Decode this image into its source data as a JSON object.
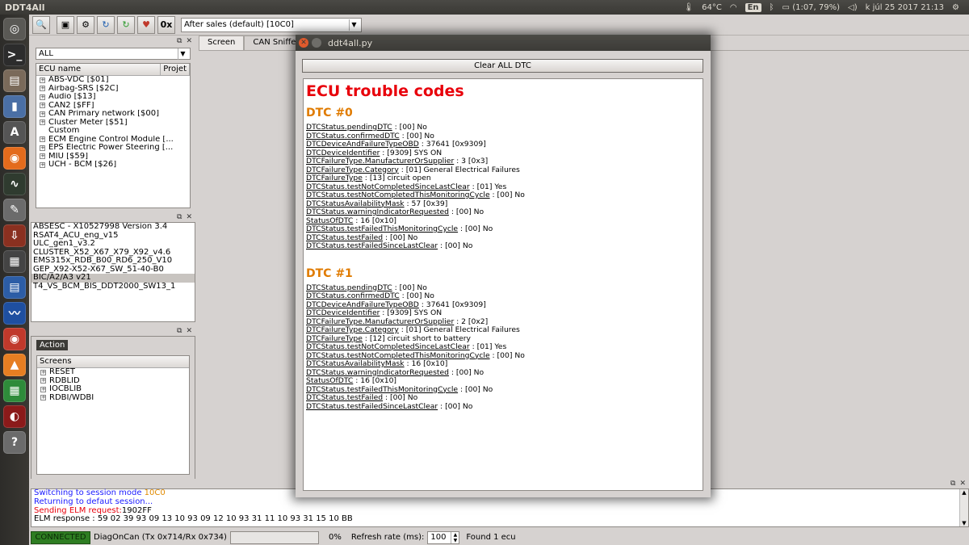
{
  "top_panel": {
    "app_title": "DDT4All",
    "temperature": "64°C",
    "keyboard_layout": "En",
    "battery": "(1:07, 79%)",
    "datetime": "k júl 25 2017 21:13"
  },
  "toolbar": {
    "ecu_select_value": "After sales (default) [10C0]",
    "hex_button": "0x"
  },
  "ecu_panel": {
    "filter_value": "ALL",
    "columns": [
      "ECU name",
      "Projet"
    ],
    "items": [
      {
        "label": "ABS-VDC [$01]",
        "expandable": true
      },
      {
        "label": "Airbag-SRS [$2C]",
        "expandable": true
      },
      {
        "label": "Audio [$13]",
        "expandable": true
      },
      {
        "label": "CAN2 [$FF]",
        "expandable": true
      },
      {
        "label": "CAN Primary network [$00]",
        "expandable": true
      },
      {
        "label": "Cluster Meter [$51]",
        "expandable": true
      },
      {
        "label": "Custom",
        "expandable": false
      },
      {
        "label": "ECM Engine Control Module [...",
        "expandable": true
      },
      {
        "label": "EPS Electric Power Steering [...",
        "expandable": true
      },
      {
        "label": "MIU [$59]",
        "expandable": true
      },
      {
        "label": "UCH - BCM [$26]",
        "expandable": true
      }
    ]
  },
  "files_panel": {
    "items": [
      "ABSESC - X10527998 Version 3.4",
      "RSAT4_ACU_eng_v15",
      "ULC_gen1_v3.2",
      "CLUSTER_X52_X67_X79_X92_v4.6",
      "EMS315x_RDB_B00_RD6_250_V10",
      "GEP_X92-X52-X67_SW_51-40-B0",
      "BIC/A2/A3 v21",
      "T4_VS_BCM_BIS_DDT2000_SW13_1"
    ],
    "selected_index": 6
  },
  "screens_panel": {
    "action_label": "Action",
    "header": "Screens",
    "items": [
      "RESET",
      "RDBLID",
      "IOCBLIB",
      "RDBI/WDBI"
    ]
  },
  "main_tabs": [
    "Screen",
    "CAN Sniffer"
  ],
  "log": {
    "lines": [
      {
        "text": "Switching to session mode ",
        "suffix": "10C0",
        "color": "#1a1aff",
        "suffix_color": "#e08a00"
      },
      {
        "text": "Returning to defaut session...",
        "suffix": "",
        "color": "#1a1aff",
        "suffix_color": ""
      },
      {
        "text": "Sending ELM request:",
        "suffix": "1902FF",
        "color": "#e8000b",
        "suffix_color": "#000000"
      },
      {
        "text": "ELM response : 59 02 39 93 09 13 10 93 09 12 10 93 31 11 10 93 31 15 10 BB",
        "suffix": "",
        "color": "#000000",
        "suffix_color": ""
      }
    ]
  },
  "status_bar": {
    "connection": "CONNECTED",
    "protocol": "DiagOnCan (Tx 0x714/Rx 0x734)",
    "progress_percent": "0%",
    "progress_value": 0,
    "refresh_label": "Refresh rate (ms):",
    "refresh_value": "100",
    "result": "Found 1 ecu"
  },
  "dtc_window": {
    "title": "ddt4all.py",
    "clear_button": "Clear ALL DTC",
    "heading": "ECU trouble codes",
    "dtcs": [
      {
        "title": "DTC #0",
        "fields": [
          {
            "key": "DTCStatus.pendingDTC",
            "value": " : [00] No"
          },
          {
            "key": "DTCStatus.confirmedDTC",
            "value": " : [00] No"
          },
          {
            "key": "DTCDeviceAndFailureTypeOBD",
            "value": " : 37641 [0x9309]"
          },
          {
            "key": "DTCDeviceIdentifier",
            "value": " : [9309] SYS ON"
          },
          {
            "key": "DTCFailureType.ManufacturerOrSupplier",
            "value": " : 3 [0x3]"
          },
          {
            "key": "DTCFailureType.Category",
            "value": " : [01] General Electrical Failures"
          },
          {
            "key": "DTCFailureType",
            "value": " : [13] circuit open"
          },
          {
            "key": "DTCStatus.testNotCompletedSinceLastClear",
            "value": " : [01] Yes"
          },
          {
            "key": "DTCStatus.testNotCompletedThisMonitoringCycle",
            "value": " : [00] No"
          },
          {
            "key": "DTCStatusAvailabilityMask",
            "value": " : 57 [0x39]"
          },
          {
            "key": "DTCStatus.warningIndicatorRequested",
            "value": " : [00] No"
          },
          {
            "key": "StatusOfDTC",
            "value": " : 16 [0x10]"
          },
          {
            "key": "DTCStatus.testFailedThisMonitoringCycle",
            "value": " : [00] No"
          },
          {
            "key": "DTCStatus.testFailed",
            "value": " : [00] No"
          },
          {
            "key": "DTCStatus.testFailedSinceLastClear",
            "value": " : [00] No"
          }
        ]
      },
      {
        "title": "DTC #1",
        "fields": [
          {
            "key": "DTCStatus.pendingDTC",
            "value": " : [00] No"
          },
          {
            "key": "DTCStatus.confirmedDTC",
            "value": " : [00] No"
          },
          {
            "key": "DTCDeviceAndFailureTypeOBD",
            "value": " : 37641 [0x9309]"
          },
          {
            "key": "DTCDeviceIdentifier",
            "value": " : [9309] SYS ON"
          },
          {
            "key": "DTCFailureType.ManufacturerOrSupplier",
            "value": " : 2 [0x2]"
          },
          {
            "key": "DTCFailureType.Category",
            "value": " : [01] General Electrical Failures"
          },
          {
            "key": "DTCFailureType",
            "value": " : [12] circuit short to battery"
          },
          {
            "key": "DTCStatus.testNotCompletedSinceLastClear",
            "value": " : [01] Yes"
          },
          {
            "key": "DTCStatus.testNotCompletedThisMonitoringCycle",
            "value": " : [00] No"
          },
          {
            "key": "DTCStatusAvailabilityMask",
            "value": " : 16 [0x10]"
          },
          {
            "key": "DTCStatus.warningIndicatorRequested",
            "value": " : [00] No"
          },
          {
            "key": "StatusOfDTC",
            "value": " : 16 [0x10]"
          },
          {
            "key": "DTCStatus.testFailedThisMonitoringCycle",
            "value": " : [00] No"
          },
          {
            "key": "DTCStatus.testFailed",
            "value": " : [00] No"
          },
          {
            "key": "DTCStatus.testFailedSinceLastClear",
            "value": " : [00] No"
          }
        ]
      }
    ]
  },
  "launcher": [
    {
      "name": "ubuntu-icon",
      "color": "#5a5955",
      "glyph": "◎"
    },
    {
      "name": "terminal-icon",
      "color": "#2c2c2c",
      "glyph": ">_"
    },
    {
      "name": "files-icon",
      "color": "#7a6a5a",
      "glyph": "▤"
    },
    {
      "name": "thermometer-icon",
      "color": "#4a6fa5",
      "glyph": "▮"
    },
    {
      "name": "software-center-icon",
      "color": "#555555",
      "glyph": "A"
    },
    {
      "name": "firefox-icon",
      "color": "#e36b1c",
      "glyph": "◉"
    },
    {
      "name": "system-monitor-icon",
      "color": "#2f3b2f",
      "glyph": "∿"
    },
    {
      "name": "text-editor-icon",
      "color": "#6b6b6b",
      "glyph": "✎"
    },
    {
      "name": "downloader-icon",
      "color": "#8a3020",
      "glyph": "⇩"
    },
    {
      "name": "calculator-icon",
      "color": "#444444",
      "glyph": "▦"
    },
    {
      "name": "writer-icon",
      "color": "#2c5da6",
      "glyph": "▤"
    },
    {
      "name": "oscilloscope-icon",
      "color": "#1e4fa0",
      "glyph": "〰"
    },
    {
      "name": "chrome-icon",
      "color": "#c0392b",
      "glyph": "◉"
    },
    {
      "name": "vlc-icon",
      "color": "#e67e22",
      "glyph": "▲"
    },
    {
      "name": "calc-sheet-icon",
      "color": "#2e8b3a",
      "glyph": "▦"
    },
    {
      "name": "car-diag-icon",
      "color": "#8b1a1a",
      "glyph": "◐"
    },
    {
      "name": "help-icon",
      "color": "#6b6b6b",
      "glyph": "?"
    }
  ]
}
